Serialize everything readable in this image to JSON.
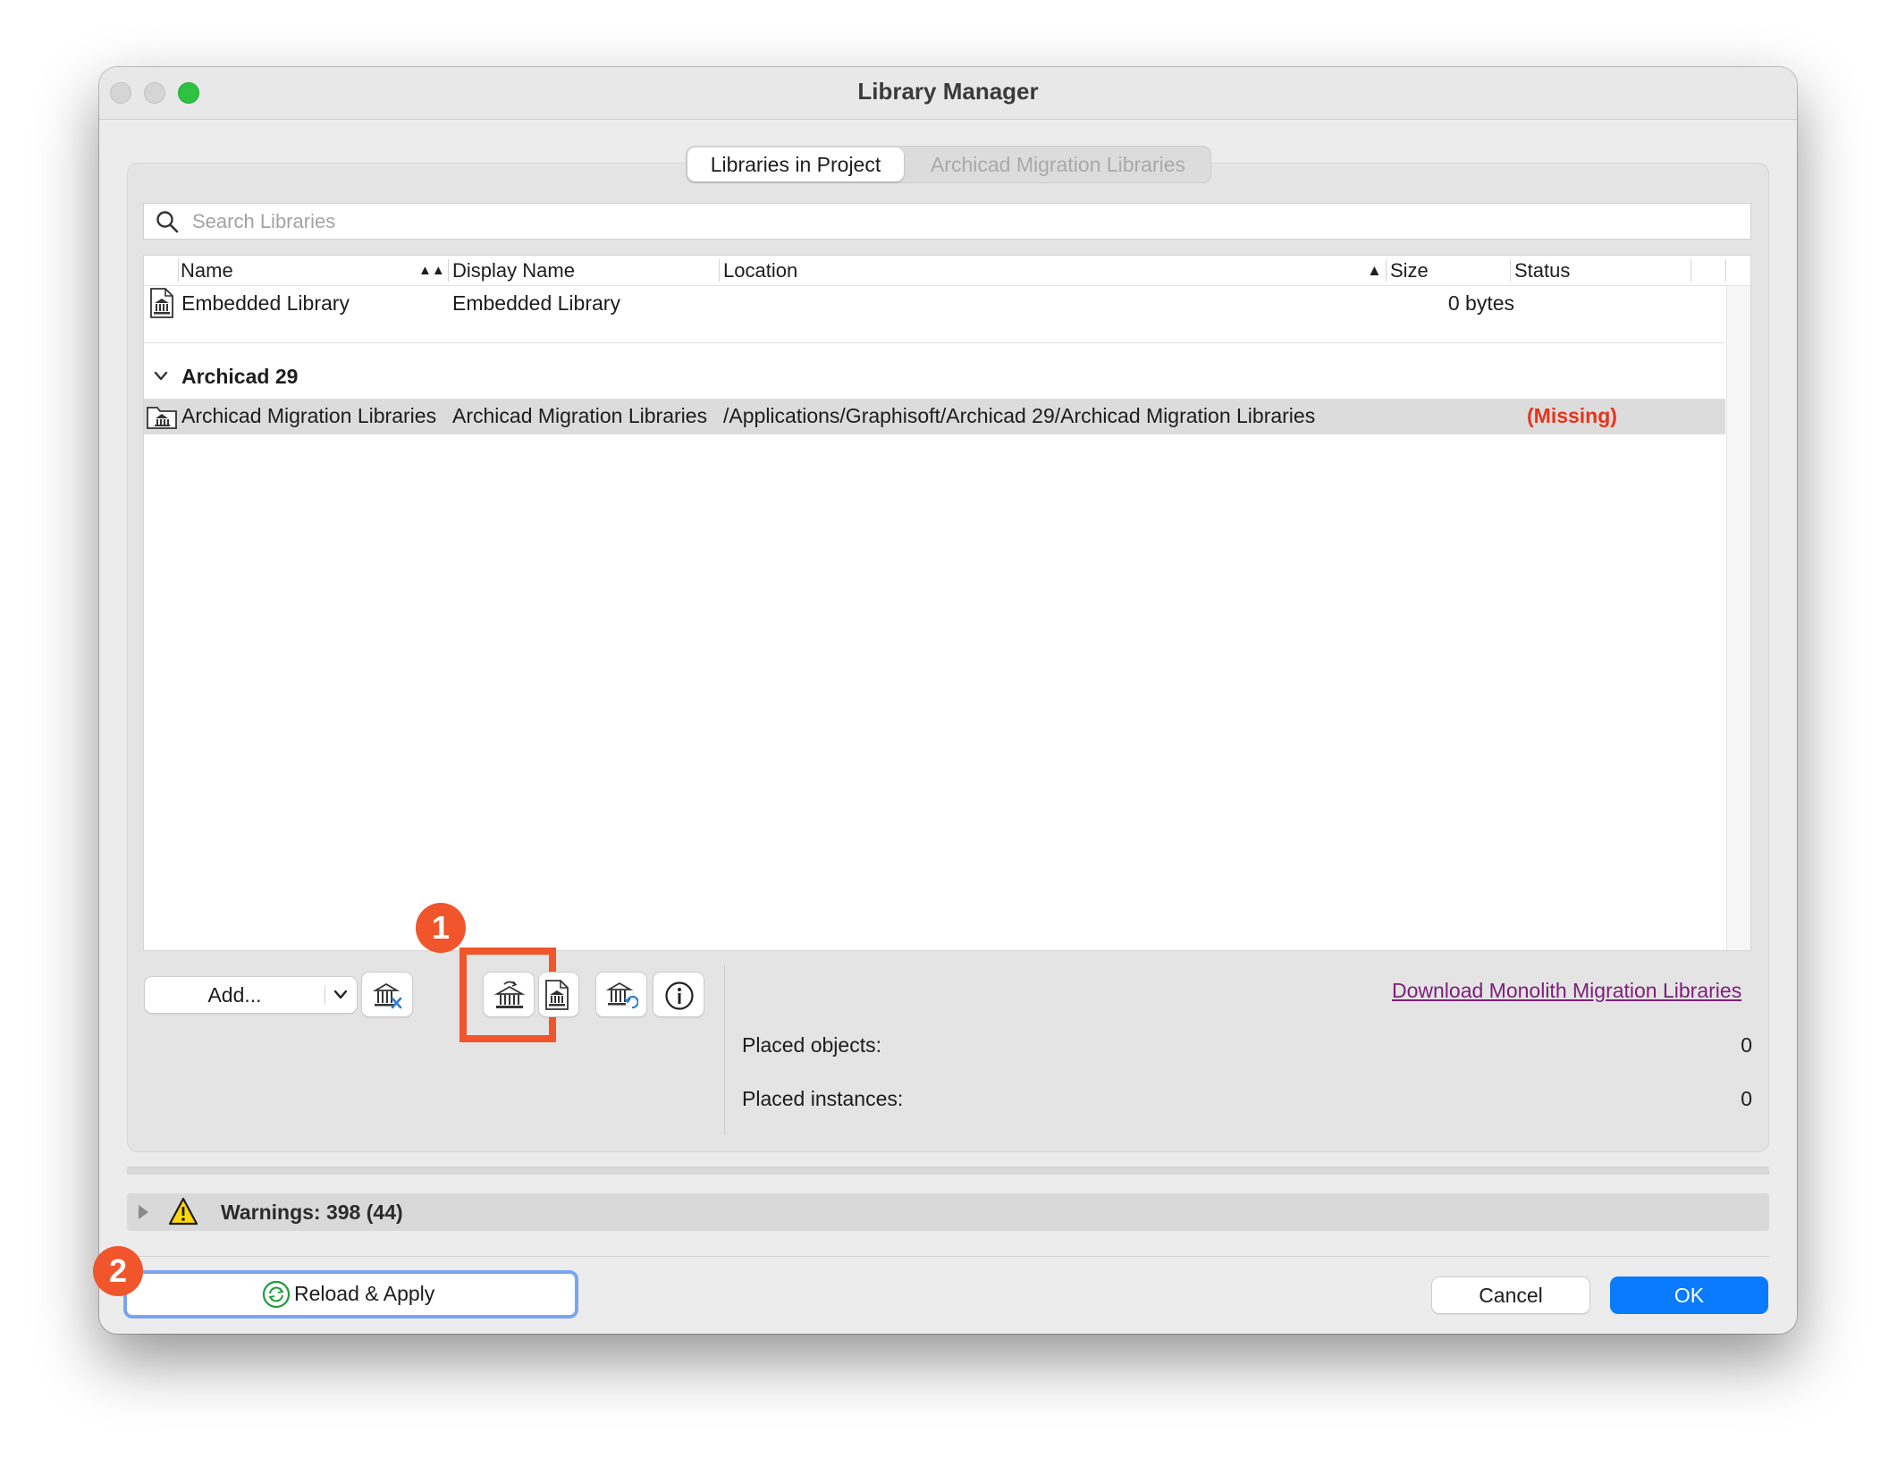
{
  "window": {
    "title": "Library Manager"
  },
  "tabs": [
    {
      "label": "Libraries in Project",
      "active": true
    },
    {
      "label": "Archicad Migration Libraries",
      "active": false
    }
  ],
  "search": {
    "placeholder": "Search Libraries",
    "value": ""
  },
  "table": {
    "columns": [
      "Name",
      "Display Name",
      "Location",
      "Size",
      "Status"
    ],
    "rows": [
      {
        "name": "Embedded Library",
        "display_name": "Embedded Library",
        "location": "",
        "size": "0 bytes",
        "status": ""
      }
    ],
    "groups": [
      {
        "title": "Archicad 29",
        "rows": [
          {
            "name": "Archicad Migration Libraries",
            "display_name": "Archicad Migration Libraries",
            "location": "/Applications/Graphisoft/Archicad 29/Archicad Migration Libraries",
            "size": "",
            "status": "(Missing)",
            "selected": true
          }
        ]
      }
    ]
  },
  "toolbar": {
    "add_label": "Add..."
  },
  "details": {
    "download_link": "Download Monolith Migration Libraries",
    "placed_objects_label": "Placed objects:",
    "placed_objects_value": "0",
    "placed_instances_label": "Placed instances:",
    "placed_instances_value": "0"
  },
  "warnings": {
    "label": "Warnings: 398 (44)"
  },
  "footer": {
    "reload_label": "Reload & Apply",
    "cancel_label": "Cancel",
    "ok_label": "OK"
  },
  "annotations": {
    "badge1": "1",
    "badge2": "2",
    "highlight_color": "#f0552b"
  },
  "colors": {
    "accent": "#0a7aff",
    "missing": "#e8331b",
    "link": "#7c1f7a",
    "selected_row": "#dcdcdc"
  }
}
